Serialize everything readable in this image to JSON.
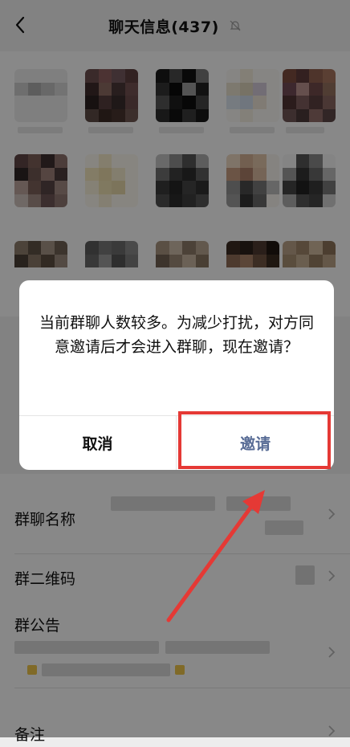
{
  "header": {
    "title": "聊天信息(437)",
    "back_icon": "chevron-left-icon",
    "mute_icon": "bell-off-icon"
  },
  "settings": {
    "group_name_label": "群聊名称",
    "qr_code_label": "群二维码",
    "announcement_label": "群公告",
    "remark_label": "备注"
  },
  "dialog": {
    "message": "当前群聊人数较多。为减少打扰，对方同意邀请后才会进入群聊，现在邀请？",
    "cancel_label": "取消",
    "invite_label": "邀请"
  },
  "colors": {
    "link_blue": "#576b95",
    "annotation_red": "#e53935"
  }
}
